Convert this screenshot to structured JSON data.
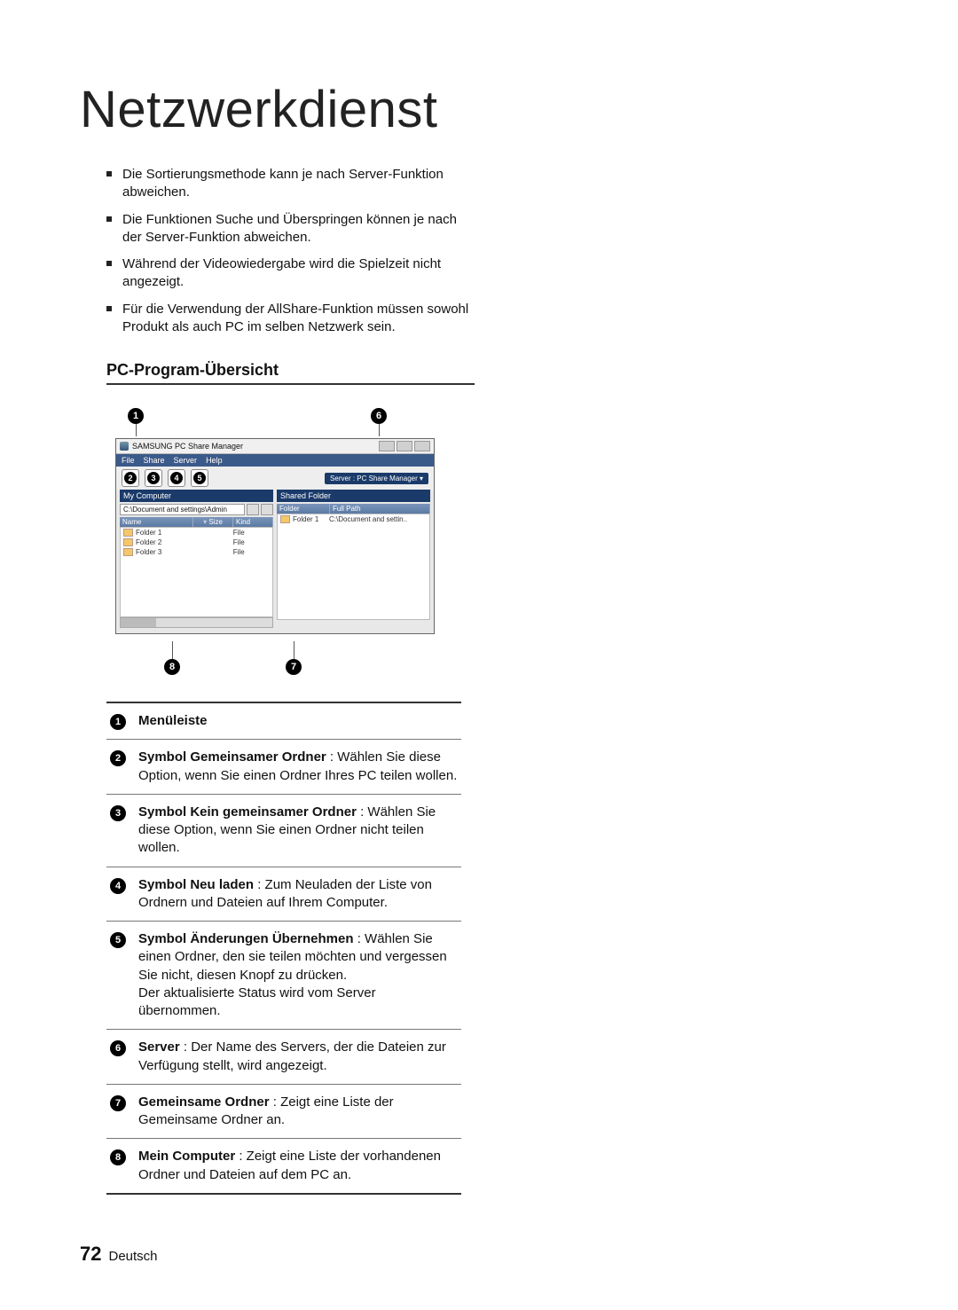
{
  "title": "Netzwerkdienst",
  "bullets": [
    "Die Sortierungsmethode kann je nach Server-Funktion abweichen.",
    "Die Funktionen Suche und Überspringen können je nach der Server-Funktion abweichen.",
    "Während der Videowiedergabe wird die Spielzeit nicht angezeigt.",
    "Für die Verwendung der AllShare-Funktion müssen sowohl Produkt als auch PC im selben Netzwerk sein."
  ],
  "subhead": "PC-Program-Übersicht",
  "callouts": {
    "c1": "1",
    "c2": "2",
    "c3": "3",
    "c4": "4",
    "c5": "5",
    "c6": "6",
    "c7": "7",
    "c8": "8"
  },
  "app": {
    "title": "SAMSUNG PC Share Manager",
    "menu": {
      "file": "File",
      "share": "Share",
      "server": "Server",
      "help": "Help"
    },
    "server_label": "Server : PC Share Manager ▾",
    "left": {
      "header": "My Computer",
      "path": "C:\\Document and settings\\Admin",
      "cols": {
        "name": "Name",
        "size": "Size",
        "kind": "Kind"
      },
      "rows": [
        {
          "name": "Folder 1",
          "kind": "File"
        },
        {
          "name": "Folder 2",
          "kind": "File"
        },
        {
          "name": "Folder 3",
          "kind": "File"
        }
      ]
    },
    "right": {
      "header": "Shared Folder",
      "cols": {
        "folder": "Folder",
        "path": "Full Path"
      },
      "rows": [
        {
          "folder": "Folder 1",
          "path": "C:\\Document and settin.."
        }
      ]
    }
  },
  "legend": [
    {
      "num": "1",
      "bold": "Menüleiste",
      "rest": ""
    },
    {
      "num": "2",
      "bold": "Symbol Gemeinsamer Ordner",
      "rest": " : Wählen Sie diese Option, wenn Sie einen Ordner Ihres PC teilen wollen."
    },
    {
      "num": "3",
      "bold": "Symbol Kein gemeinsamer Ordner",
      "rest": " : Wählen Sie diese Option, wenn Sie einen Ordner nicht teilen wollen."
    },
    {
      "num": "4",
      "bold": "Symbol Neu laden",
      "rest": " : Zum Neuladen der Liste von Ordnern und Dateien auf Ihrem Computer."
    },
    {
      "num": "5",
      "bold": "Symbol Änderungen Übernehmen",
      "rest": " : Wählen Sie einen Ordner, den sie teilen möchten und vergessen Sie nicht, diesen Knopf zu drücken.\nDer aktualisierte Status wird vom Server übernommen."
    },
    {
      "num": "6",
      "bold": "Server",
      "rest": " : Der Name des Servers, der die Dateien zur Verfügung stellt, wird angezeigt."
    },
    {
      "num": "7",
      "bold": "Gemeinsame Ordner",
      "rest": " : Zeigt eine Liste der Gemeinsame Ordner an."
    },
    {
      "num": "8",
      "bold": "Mein Computer",
      "rest": " : Zeigt eine Liste der vorhandenen Ordner und Dateien auf dem PC an."
    }
  ],
  "footer": {
    "page": "72",
    "lang": "Deutsch"
  }
}
